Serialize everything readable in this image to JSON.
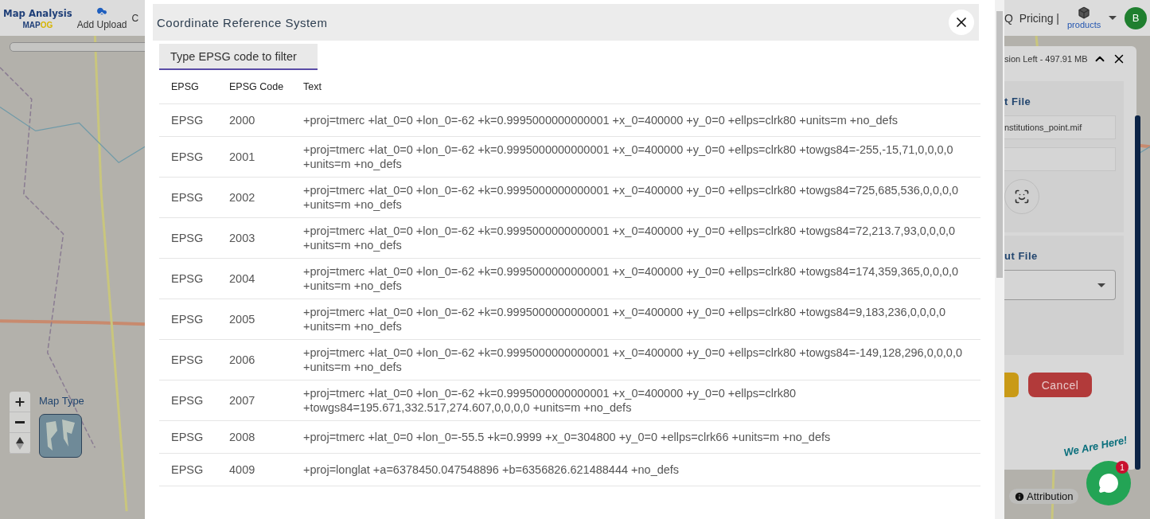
{
  "app_header": {
    "title": "Map Analysis",
    "logo_main": "MAP",
    "logo_accent": "OG",
    "upload_label": "Add Upload",
    "cut_item": "C",
    "nav_link": "Q  Pricing |",
    "products_label": "products",
    "avatar_letter": "B"
  },
  "map_controls": {
    "map_type_label": "Map Type"
  },
  "side_panel": {
    "storage_text": "sion Left - 497.91 MB",
    "input_heading": "t File",
    "file_name": "nstitutions_point.mif",
    "output_heading": "ut File",
    "cancel_label": "Cancel"
  },
  "attribution": "Attribution",
  "chat_widget": {
    "tagline": "We Are Here!",
    "badge": "1"
  },
  "dialog": {
    "title": "Coordinate Reference System",
    "filter": {
      "placeholder": "Type EPSG code to filter"
    },
    "table": {
      "columns": [
        "EPSG",
        "EPSG Code",
        "Text"
      ],
      "rows": [
        {
          "authority": "EPSG",
          "code": "2000",
          "text": "+proj=tmerc +lat_0=0 +lon_0=-62 +k=0.9995000000000001 +x_0=400000 +y_0=0 +ellps=clrk80 +units=m +no_defs"
        },
        {
          "authority": "EPSG",
          "code": "2001",
          "text": "+proj=tmerc +lat_0=0 +lon_0=-62 +k=0.9995000000000001 +x_0=400000 +y_0=0 +ellps=clrk80 +towgs84=-255,-15,71,0,0,0,0 +units=m +no_defs"
        },
        {
          "authority": "EPSG",
          "code": "2002",
          "text": "+proj=tmerc +lat_0=0 +lon_0=-62 +k=0.9995000000000001 +x_0=400000 +y_0=0 +ellps=clrk80 +towgs84=725,685,536,0,0,0,0 +units=m +no_defs"
        },
        {
          "authority": "EPSG",
          "code": "2003",
          "text": "+proj=tmerc +lat_0=0 +lon_0=-62 +k=0.9995000000000001 +x_0=400000 +y_0=0 +ellps=clrk80 +towgs84=72,213.7,93,0,0,0,0 +units=m +no_defs"
        },
        {
          "authority": "EPSG",
          "code": "2004",
          "text": "+proj=tmerc +lat_0=0 +lon_0=-62 +k=0.9995000000000001 +x_0=400000 +y_0=0 +ellps=clrk80 +towgs84=174,359,365,0,0,0,0 +units=m +no_defs"
        },
        {
          "authority": "EPSG",
          "code": "2005",
          "text": "+proj=tmerc +lat_0=0 +lon_0=-62 +k=0.9995000000000001 +x_0=400000 +y_0=0 +ellps=clrk80 +towgs84=9,183,236,0,0,0,0 +units=m +no_defs"
        },
        {
          "authority": "EPSG",
          "code": "2006",
          "text": "+proj=tmerc +lat_0=0 +lon_0=-62 +k=0.9995000000000001 +x_0=400000 +y_0=0 +ellps=clrk80 +towgs84=-149,128,296,0,0,0,0 +units=m +no_defs"
        },
        {
          "authority": "EPSG",
          "code": "2007",
          "text": "+proj=tmerc +lat_0=0 +lon_0=-62 +k=0.9995000000000001 +x_0=400000 +y_0=0 +ellps=clrk80 +towgs84=195.671,332.517,274.607,0,0,0,0 +units=m +no_defs"
        },
        {
          "authority": "EPSG",
          "code": "2008",
          "text": "+proj=tmerc +lat_0=0 +lon_0=-55.5 +k=0.9999 +x_0=304800 +y_0=0 +ellps=clrk66 +units=m +no_defs"
        },
        {
          "authority": "EPSG",
          "code": "4009",
          "text": "+proj=longlat +a=6378450.047548896 +b=6356826.621488444 +no_defs"
        }
      ]
    }
  }
}
